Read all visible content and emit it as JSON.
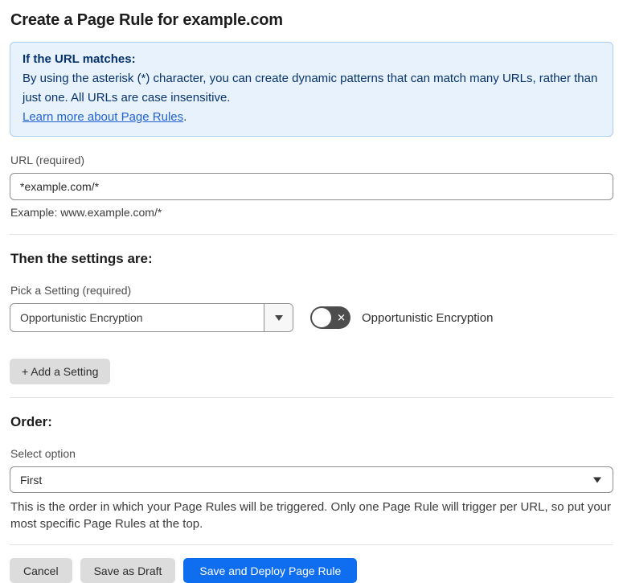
{
  "page": {
    "title": "Create a Page Rule for example.com"
  },
  "info_banner": {
    "heading": "If the URL matches:",
    "body": "By using the asterisk (*) character, you can create dynamic patterns that can match many URLs, rather than just one. All URLs are case insensitive.",
    "link_label": "Learn more about Page Rules",
    "link_suffix": "."
  },
  "url_section": {
    "label": "URL (required)",
    "value": "*example.com/*",
    "example": "Example: www.example.com/*"
  },
  "settings_section": {
    "heading": "Then the settings are:",
    "picker_label": "Pick a Setting (required)",
    "picker_value": "Opportunistic Encryption",
    "toggle_label": "Opportunistic Encryption",
    "toggle_state": "off",
    "toggle_x_glyph": "✕",
    "add_button_label": "+ Add a Setting"
  },
  "order_section": {
    "heading": "Order:",
    "select_label": "Select option",
    "select_value": "First",
    "description": "This is the order in which your Page Rules will be triggered. Only one Page Rule will trigger per URL, so put your most specific Page Rules at the top."
  },
  "footer": {
    "cancel_label": "Cancel",
    "save_draft_label": "Save as Draft",
    "save_deploy_label": "Save and Deploy Page Rule"
  },
  "colors": {
    "banner_bg": "#e8f2fc",
    "banner_border": "#abcdee",
    "banner_text": "#07336e",
    "link_blue": "#2262d3",
    "primary_blue": "#0f6df0",
    "gray_button_bg": "#dcdcdc",
    "toggle_off_bg": "#4d4d4d"
  }
}
